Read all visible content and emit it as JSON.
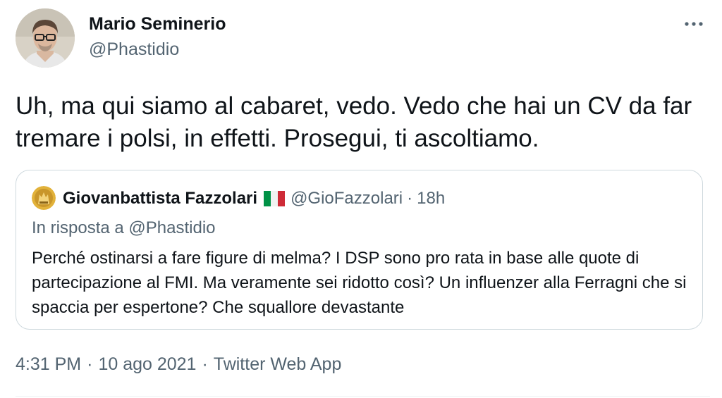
{
  "tweet": {
    "author": {
      "name": "Mario Seminerio",
      "handle": "@Phastidio"
    },
    "text": "Uh, ma qui siamo al cabaret, vedo. Vedo che hai un CV da far tremare i polsi, in effetti. Prosegui, ti ascoltiamo.",
    "more_icon": "more-horizontal-icon",
    "quote": {
      "author_name": "Giovanbattista Fazzolari",
      "flag_icon": "italy-flag-icon",
      "handle": "@GioFazzolari",
      "separator": "·",
      "time": "18h",
      "reply_to": "In risposta a @Phastidio",
      "text": "Perché ostinarsi a fare figure di melma? I DSP sono pro rata in base alle quote di partecipazione al FMI. Ma veramente sei ridotto così? Un influenzer alla Ferragni che si spaccia per espertone? Che squallore devastante"
    },
    "meta": {
      "time": "4:31 PM",
      "separator": "·",
      "date": "10 ago 2021",
      "source": "Twitter Web App"
    }
  },
  "colors": {
    "text_primary": "#0f1419",
    "text_secondary": "#536471",
    "border": "#cfd9de"
  }
}
